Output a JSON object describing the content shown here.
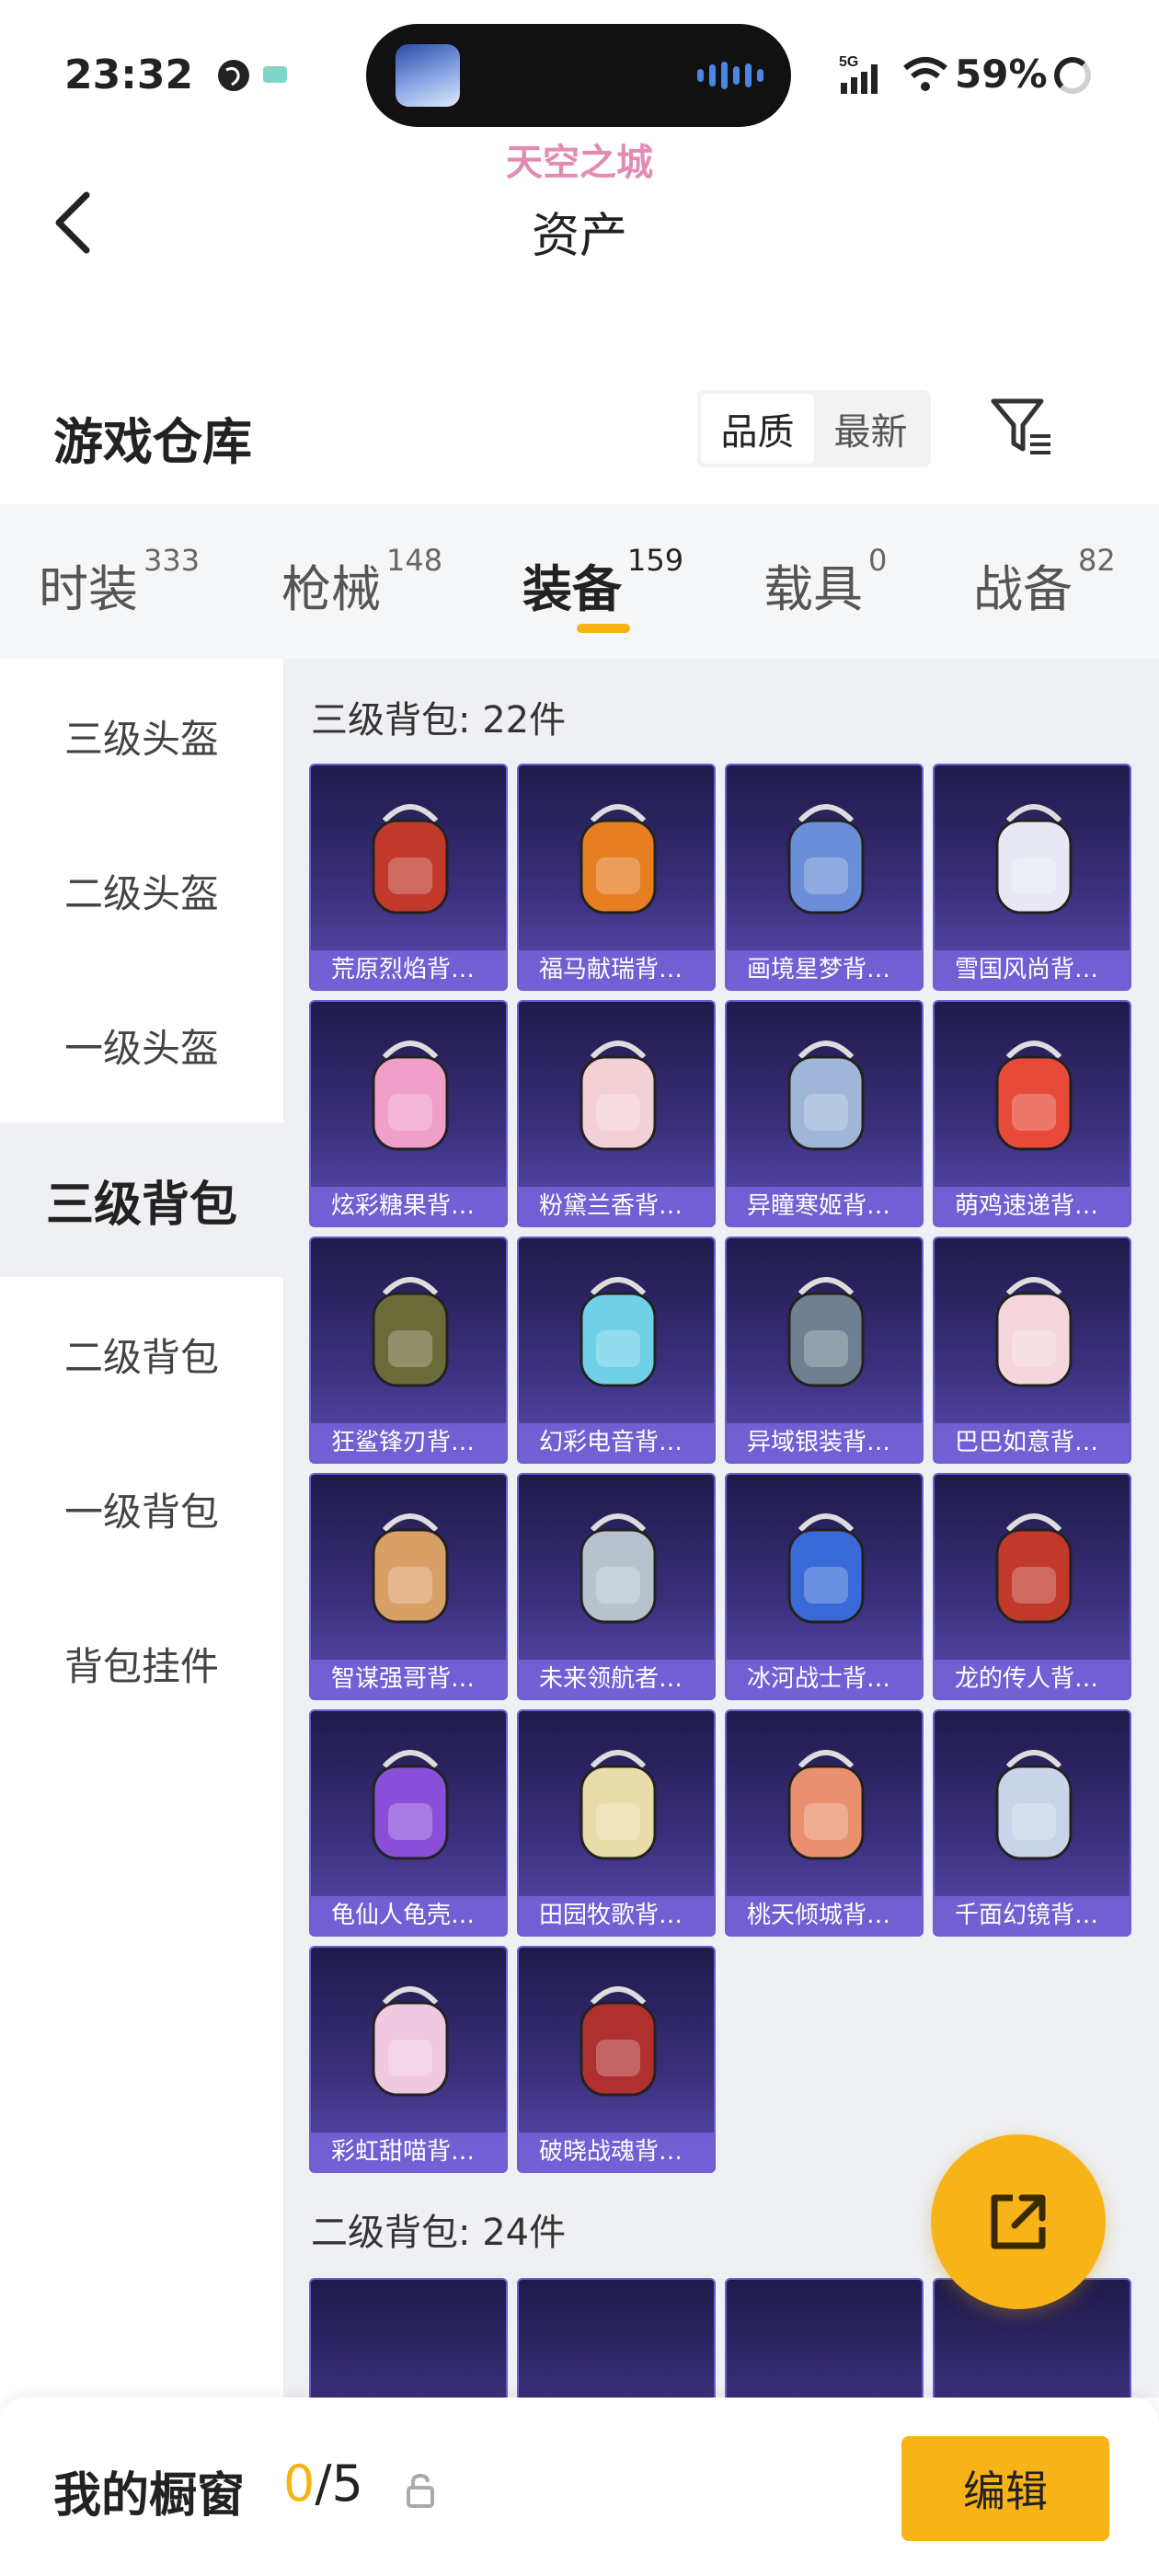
{
  "status_bar": {
    "time": "23:32",
    "network": "5G",
    "battery": "59%"
  },
  "watermark": "天空之城",
  "header": {
    "title": "资产"
  },
  "warehouse": {
    "title": "游戏仓库",
    "sort_options": [
      "品质",
      "最新"
    ],
    "sort_selected": "品质"
  },
  "tabs": [
    {
      "label": "时装",
      "count": "333"
    },
    {
      "label": "枪械",
      "count": "148"
    },
    {
      "label": "装备",
      "count": "159"
    },
    {
      "label": "载具",
      "count": "0"
    },
    {
      "label": "战备",
      "count": "82"
    }
  ],
  "active_tab": "装备",
  "side_nav": [
    "三级头盔",
    "二级头盔",
    "一级头盔",
    "三级背包",
    "二级背包",
    "一级背包",
    "背包挂件"
  ],
  "active_side": "三级背包",
  "groups": [
    {
      "title": "三级背包: 22件",
      "items": [
        "荒原烈焰背…",
        "福马献瑞背…",
        "画境星梦背…",
        "雪国风尚背…",
        "炫彩糖果背…",
        "粉黛兰香背…",
        "异瞳寒姬背…",
        "萌鸡速递背…",
        "狂鲨锋刃背…",
        "幻彩电音背…",
        "异域银装背…",
        "巴巴如意背…",
        "智谋强哥背…",
        "未来领航者…",
        "冰河战士背…",
        "龙的传人背…",
        "龟仙人龟壳…",
        "田园牧歌背…",
        "桃天倾城背…",
        "千面幻镜背…",
        "彩虹甜喵背…",
        "破晓战魂背…"
      ]
    },
    {
      "title": "二级背包: 24件",
      "items": []
    }
  ],
  "bottom_bar": {
    "label": "我的橱窗",
    "current": "0",
    "total": "/5",
    "edit_label": "编辑"
  },
  "colors": {
    "accent": "#f8b318",
    "card_bg": "#3a2f7a",
    "tab_bg": "#f4f6f8"
  }
}
